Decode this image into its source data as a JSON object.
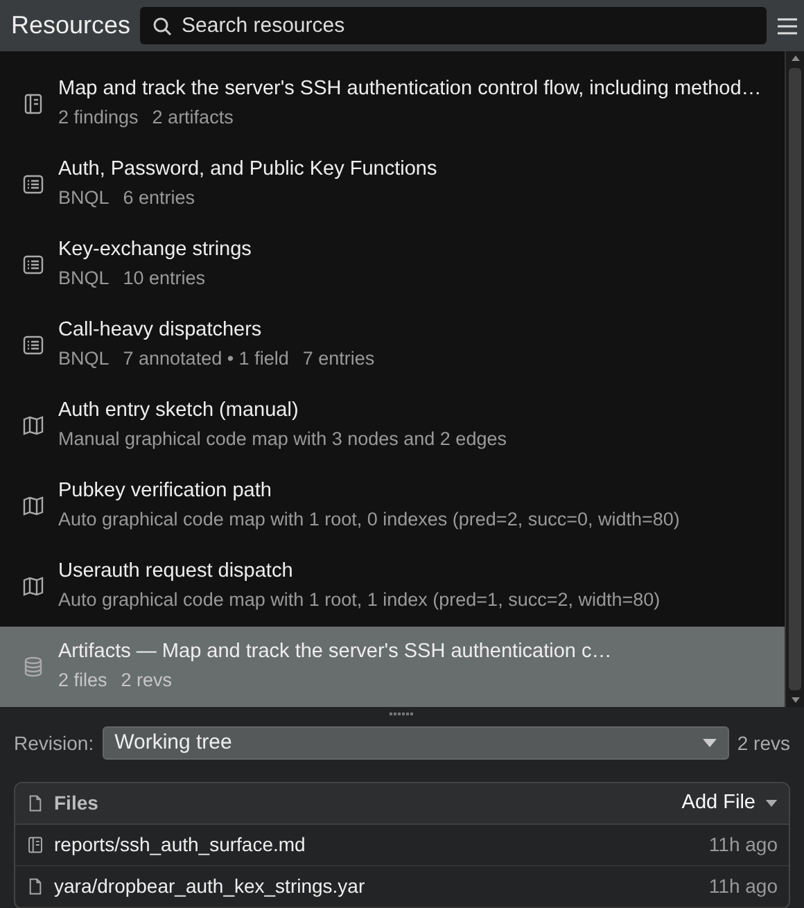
{
  "header": {
    "title": "Resources",
    "search": {
      "placeholder": "Search resources"
    }
  },
  "items": [
    {
      "kind": "notebook",
      "title": "Map and track the server's SSH authentication control flow, including method…",
      "meta": [
        "2 findings",
        "2 artifacts"
      ],
      "selected": false
    },
    {
      "kind": "list",
      "title": "Auth, Password, and Public Key Functions",
      "meta": [
        "BNQL",
        "6 entries"
      ],
      "selected": false
    },
    {
      "kind": "list",
      "title": "Key-exchange strings",
      "meta": [
        "BNQL",
        "10 entries"
      ],
      "selected": false
    },
    {
      "kind": "list",
      "title": "Call-heavy dispatchers",
      "meta": [
        "BNQL",
        "7 annotated • 1 field",
        "7 entries"
      ],
      "selected": false
    },
    {
      "kind": "map",
      "title": "Auth entry sketch (manual)",
      "meta": [
        "Manual graphical code map with 3 nodes and 2 edges"
      ],
      "selected": false
    },
    {
      "kind": "map",
      "title": "Pubkey verification path",
      "meta": [
        "Auto graphical code map with 1 root, 0 indexes (pred=2, succ=0, width=80)"
      ],
      "selected": false
    },
    {
      "kind": "map",
      "title": "Userauth request dispatch",
      "meta": [
        "Auto graphical code map with 1 root, 1 index (pred=1, succ=2, width=80)"
      ],
      "selected": false
    },
    {
      "kind": "database",
      "title": "Artifacts — Map and track the server's SSH authentication c…",
      "meta": [
        "2 files",
        "2 revs"
      ],
      "selected": true
    }
  ],
  "revision": {
    "label": "Revision:",
    "value": "Working tree",
    "count": "2 revs"
  },
  "files": {
    "title": "Files",
    "add": "Add File",
    "rows": [
      {
        "kind": "notebook",
        "path": "reports/ssh_auth_surface.md",
        "time": "11h ago"
      },
      {
        "kind": "file",
        "path": "yara/dropbear_auth_kex_strings.yar",
        "time": "11h ago"
      }
    ]
  }
}
